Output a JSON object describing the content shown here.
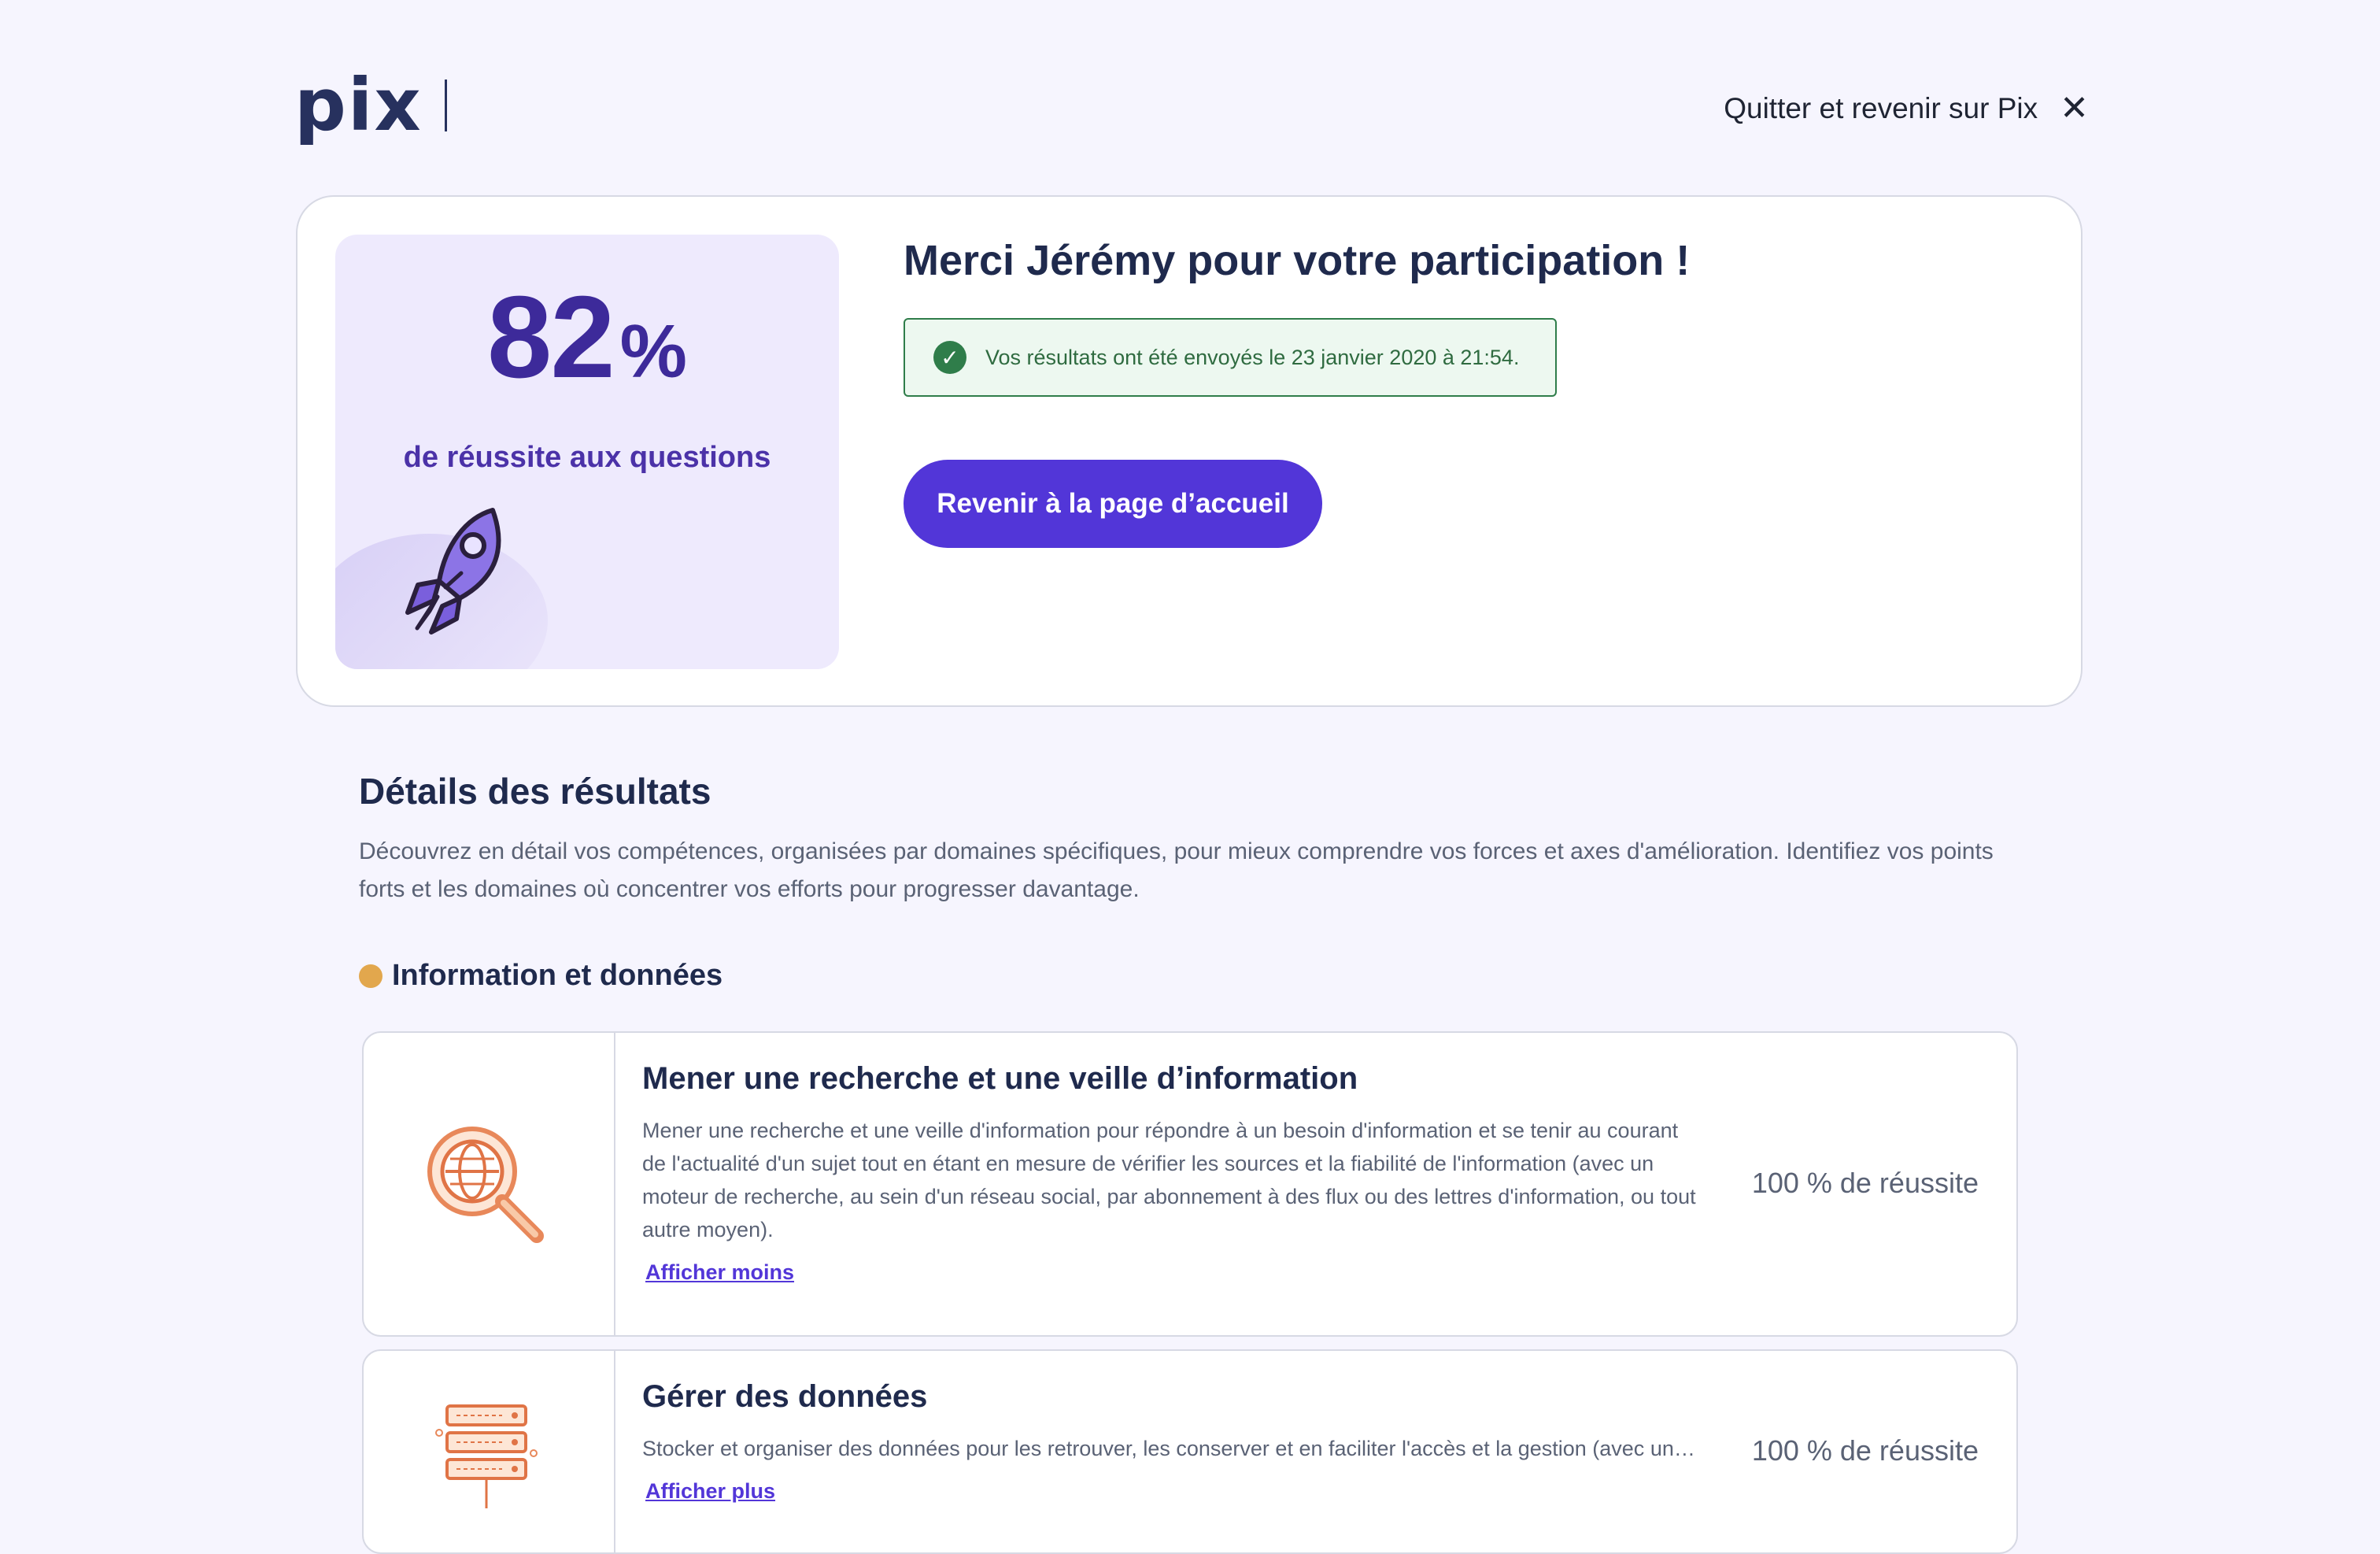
{
  "header": {
    "logo_text": "pix",
    "quit_label": "Quitter et revenir sur Pix",
    "quit_icon": "close-icon"
  },
  "hero": {
    "score_value": "82",
    "score_unit": "%",
    "score_label": "de réussite aux questions",
    "title": "Merci Jérémy pour votre participation !",
    "notice_text": "Vos résultats ont été envoyés le 23 janvier 2020 à 21:54.",
    "home_button": "Revenir à la page d’accueil",
    "colors": {
      "accent": "#5236d8",
      "success": "#2f7d4a",
      "score": "#3d2a9a"
    }
  },
  "details": {
    "title": "Détails des résultats",
    "description": "Découvrez en détail vos compétences, organisées par domaines spécifiques, pour mieux comprendre vos forces et axes d'amélioration. Identifiez vos points forts et les domaines où concentrer vos efforts pour progresser davantage.",
    "domain": {
      "title": "Information et données",
      "color": "#e2a74d"
    },
    "competences": [
      {
        "title": "Mener une recherche et une veille d’information",
        "description": "Mener une recherche et une veille d'information pour répondre à un besoin d'information et se tenir au courant de l'actualité d'un sujet tout en étant en mesure de vérifier les sources et la fiabilité de l'information (avec un moteur de recherche, au sein d'un réseau social, par abonnement à des flux ou des lettres d'information, ou tout autre moyen).",
        "link": "Afficher moins",
        "score": "100 % de réussite",
        "icon": "magnifier-globe-icon"
      },
      {
        "title": "Gérer des données",
        "description": "Stocker et organiser des données pour les retrouver, les conserver et en faciliter l'accès et la gestion (avec un gestionnaire de fichiers, un espace de stockage en ligne, des tableurs, des bases de données, un système d'information, etc.).",
        "link": "Afficher plus",
        "score": "100 % de réussite",
        "icon": "database-servers-icon"
      }
    ]
  }
}
